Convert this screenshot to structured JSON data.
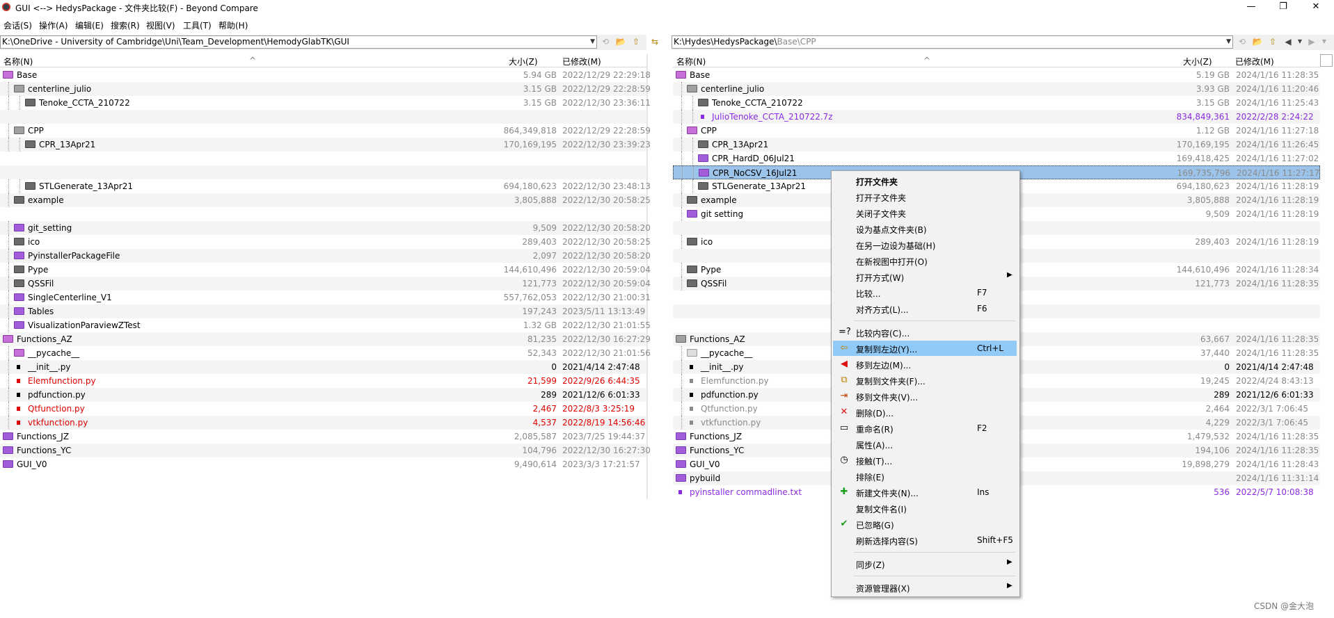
{
  "window": {
    "title": "GUI <--> HedysPackage - 文件夹比较(F) - Beyond Compare",
    "minimize": "—",
    "maximize": "❐",
    "close": "✕"
  },
  "menu": [
    "会话(S)",
    "操作(A)",
    "编辑(E)",
    "搜索(R)",
    "视图(V)",
    "工具(T)",
    "帮助(H)"
  ],
  "left_path": "K:\\OneDrive - University of Cambridge\\Uni\\Team_Development\\HemodyGlabTK\\GUI",
  "right_path_main": "K:\\Hydes\\HedysPackage\\",
  "right_path_tail": "Base\\CPP",
  "columns": {
    "name": "名称(N)",
    "size": "大小(Z)",
    "modified": "已修改(M)"
  },
  "left_rows": [
    {
      "name": "Base",
      "size": "5.94 GB",
      "date": "2022/12/29 22:29:18",
      "icon": "open",
      "indent": 0,
      "style": ""
    },
    {
      "name": "centerline_julio",
      "size": "3.15 GB",
      "date": "2022/12/29 22:28:59",
      "icon": "opengray",
      "indent": 1,
      "style": ""
    },
    {
      "name": "Tenoke_CCTA_210722",
      "size": "3.15 GB",
      "date": "2022/12/30 23:36:11",
      "icon": "gray",
      "indent": 2,
      "style": ""
    },
    {
      "name": "",
      "size": "",
      "date": "",
      "icon": "",
      "indent": 0,
      "style": ""
    },
    {
      "name": "CPP",
      "size": "864,349,818",
      "date": "2022/12/29 22:28:59",
      "icon": "opengray",
      "indent": 1,
      "style": ""
    },
    {
      "name": "CPR_13Apr21",
      "size": "170,169,195",
      "date": "2022/12/30 23:39:23",
      "icon": "gray",
      "indent": 2,
      "style": ""
    },
    {
      "name": "",
      "size": "",
      "date": "",
      "icon": "",
      "indent": 0,
      "style": ""
    },
    {
      "name": "",
      "size": "",
      "date": "",
      "icon": "",
      "indent": 0,
      "style": ""
    },
    {
      "name": "STLGenerate_13Apr21",
      "size": "694,180,623",
      "date": "2022/12/30 23:48:13",
      "icon": "gray",
      "indent": 2,
      "style": ""
    },
    {
      "name": "example",
      "size": "3,805,888",
      "date": "2022/12/30 20:58:25",
      "icon": "gray",
      "indent": 1,
      "style": ""
    },
    {
      "name": "",
      "size": "",
      "date": "",
      "icon": "",
      "indent": 0,
      "style": ""
    },
    {
      "name": "git_setting",
      "size": "9,509",
      "date": "2022/12/30 20:58:20",
      "icon": "purple",
      "indent": 1,
      "style": ""
    },
    {
      "name": "ico",
      "size": "289,403",
      "date": "2022/12/30 20:58:25",
      "icon": "gray",
      "indent": 1,
      "style": ""
    },
    {
      "name": "PyinstallerPackageFile",
      "size": "2,097",
      "date": "2022/12/30 20:58:20",
      "icon": "purple",
      "indent": 1,
      "style": ""
    },
    {
      "name": "Pype",
      "size": "144,610,496",
      "date": "2022/12/30 20:59:04",
      "icon": "gray",
      "indent": 1,
      "style": ""
    },
    {
      "name": "QSSFil",
      "size": "121,773",
      "date": "2022/12/30 20:59:04",
      "icon": "gray",
      "indent": 1,
      "style": ""
    },
    {
      "name": "SingleCenterline_V1",
      "size": "557,762,053",
      "date": "2022/12/30 21:00:31",
      "icon": "purple",
      "indent": 1,
      "style": ""
    },
    {
      "name": "Tables",
      "size": "197,243",
      "date": "2023/5/11 13:13:49",
      "icon": "purple",
      "indent": 1,
      "style": ""
    },
    {
      "name": "VisualizationParaviewZTest",
      "size": "1.32 GB",
      "date": "2022/12/30 21:01:55",
      "icon": "purple",
      "indent": 1,
      "style": ""
    },
    {
      "name": "Functions_AZ",
      "size": "81,235",
      "date": "2022/12/30 16:27:29",
      "icon": "open",
      "indent": 0,
      "style": ""
    },
    {
      "name": "__pycache__",
      "size": "52,343",
      "date": "2022/12/30 21:01:56",
      "icon": "open",
      "indent": 1,
      "style": ""
    },
    {
      "name": "__init__.py",
      "size": "0",
      "date": "2021/4/14 2:47:48",
      "icon": "file",
      "indent": 1,
      "style": "black"
    },
    {
      "name": "Elemfunction.py",
      "size": "21,599",
      "date": "2022/9/26 6:44:35",
      "icon": "filered",
      "indent": 1,
      "style": "red"
    },
    {
      "name": "pdfunction.py",
      "size": "289",
      "date": "2021/12/6 6:01:33",
      "icon": "file",
      "indent": 1,
      "style": "black"
    },
    {
      "name": "Qtfunction.py",
      "size": "2,467",
      "date": "2022/8/3 3:25:19",
      "icon": "filered",
      "indent": 1,
      "style": "red"
    },
    {
      "name": "vtkfunction.py",
      "size": "4,537",
      "date": "2022/8/19 14:56:46",
      "icon": "filered",
      "indent": 1,
      "style": "red"
    },
    {
      "name": "Functions_JZ",
      "size": "2,085,587",
      "date": "2023/7/25 19:44:37",
      "icon": "purple",
      "indent": 0,
      "style": ""
    },
    {
      "name": "Functions_YC",
      "size": "104,796",
      "date": "2022/12/30 16:27:30",
      "icon": "purple",
      "indent": 0,
      "style": ""
    },
    {
      "name": "GUI_V0",
      "size": "9,490,614",
      "date": "2023/3/3 17:21:57",
      "icon": "purple",
      "indent": 0,
      "style": ""
    }
  ],
  "right_rows": [
    {
      "name": "Base",
      "size": "5.19 GB",
      "date": "2024/1/16 11:28:35",
      "icon": "open",
      "indent": 0,
      "style": ""
    },
    {
      "name": "centerline_julio",
      "size": "3.93 GB",
      "date": "2024/1/16 11:20:46",
      "icon": "opengray",
      "indent": 1,
      "style": ""
    },
    {
      "name": "Tenoke_CCTA_210722",
      "size": "3.15 GB",
      "date": "2024/1/16 11:25:43",
      "icon": "gray",
      "indent": 2,
      "style": ""
    },
    {
      "name": "JulioTenoke_CCTA_210722.7z",
      "size": "834,849,361",
      "date": "2022/2/28 2:24:22",
      "icon": "purplefile",
      "indent": 2,
      "style": "purple"
    },
    {
      "name": "CPP",
      "size": "1.12 GB",
      "date": "2024/1/16 11:27:18",
      "icon": "open",
      "indent": 1,
      "style": ""
    },
    {
      "name": "CPR_13Apr21",
      "size": "170,169,195",
      "date": "2024/1/16 11:26:45",
      "icon": "gray",
      "indent": 2,
      "style": ""
    },
    {
      "name": "CPR_HardD_06Jul21",
      "size": "169,418,425",
      "date": "2024/1/16 11:27:02",
      "icon": "purple",
      "indent": 2,
      "style": ""
    },
    {
      "name": "CPR_NoCSV_16Jul21",
      "size": "169,735,796",
      "date": "2024/1/16 11:27:17",
      "icon": "purple",
      "indent": 2,
      "style": "sel"
    },
    {
      "name": "STLGenerate_13Apr21",
      "size": "694,180,623",
      "date": "2024/1/16 11:28:19",
      "icon": "gray",
      "indent": 2,
      "style": ""
    },
    {
      "name": "example",
      "size": "3,805,888",
      "date": "2024/1/16 11:28:19",
      "icon": "gray",
      "indent": 1,
      "style": ""
    },
    {
      "name": "git setting",
      "size": "9,509",
      "date": "2024/1/16 11:28:19",
      "icon": "purple",
      "indent": 1,
      "style": ""
    },
    {
      "name": "",
      "size": "",
      "date": "",
      "icon": "",
      "indent": 0,
      "style": ""
    },
    {
      "name": "ico",
      "size": "289,403",
      "date": "2024/1/16 11:28:19",
      "icon": "gray",
      "indent": 1,
      "style": ""
    },
    {
      "name": "",
      "size": "",
      "date": "",
      "icon": "",
      "indent": 0,
      "style": ""
    },
    {
      "name": "Pype",
      "size": "144,610,496",
      "date": "2024/1/16 11:28:34",
      "icon": "gray",
      "indent": 1,
      "style": ""
    },
    {
      "name": "QSSFil",
      "size": "121,773",
      "date": "2024/1/16 11:28:35",
      "icon": "gray",
      "indent": 1,
      "style": ""
    },
    {
      "name": "",
      "size": "",
      "date": "",
      "icon": "",
      "indent": 0,
      "style": ""
    },
    {
      "name": "",
      "size": "",
      "date": "",
      "icon": "",
      "indent": 0,
      "style": ""
    },
    {
      "name": "",
      "size": "",
      "date": "",
      "icon": "",
      "indent": 0,
      "style": ""
    },
    {
      "name": "Functions_AZ",
      "size": "63,667",
      "date": "2024/1/16 11:28:35",
      "icon": "opengray",
      "indent": 0,
      "style": ""
    },
    {
      "name": "__pycache__",
      "size": "37,440",
      "date": "2024/1/16 11:28:35",
      "icon": "light",
      "indent": 1,
      "style": ""
    },
    {
      "name": "__init__.py",
      "size": "0",
      "date": "2021/4/14 2:47:48",
      "icon": "file",
      "indent": 1,
      "style": "black"
    },
    {
      "name": "Elemfunction.py",
      "size": "19,245",
      "date": "2022/4/24 8:43:13",
      "icon": "filegray",
      "indent": 1,
      "style": "gray"
    },
    {
      "name": "pdfunction.py",
      "size": "289",
      "date": "2021/12/6 6:01:33",
      "icon": "file",
      "indent": 1,
      "style": "black"
    },
    {
      "name": "Qtfunction.py",
      "size": "2,464",
      "date": "2022/3/1 7:06:45",
      "icon": "filegray",
      "indent": 1,
      "style": "gray"
    },
    {
      "name": "vtkfunction.py",
      "size": "4,229",
      "date": "2022/3/1 7:06:45",
      "icon": "filegray",
      "indent": 1,
      "style": "gray"
    },
    {
      "name": "Functions_JZ",
      "size": "1,479,532",
      "date": "2024/1/16 11:28:35",
      "icon": "purple",
      "indent": 0,
      "style": ""
    },
    {
      "name": "Functions_YC",
      "size": "194,106",
      "date": "2024/1/16 11:28:35",
      "icon": "purple",
      "indent": 0,
      "style": ""
    },
    {
      "name": "GUI_V0",
      "size": "19,898,279",
      "date": "2024/1/16 11:28:43",
      "icon": "purple",
      "indent": 0,
      "style": ""
    },
    {
      "name": "pybuild",
      "size": "",
      "date": "2024/1/16 11:31:14",
      "icon": "purple",
      "indent": 0,
      "style": ""
    },
    {
      "name": "pyinstaller commadline.txt",
      "size": "536",
      "date": "2022/5/7 10:08:38",
      "icon": "purplefile",
      "indent": 0,
      "style": "purple"
    }
  ],
  "context_menu": [
    {
      "label": "打开文件夹",
      "shortcut": "",
      "bold": true,
      "icon": "",
      "icon_name": ""
    },
    {
      "label": "打开子文件夹",
      "shortcut": "",
      "icon": "",
      "icon_name": ""
    },
    {
      "label": "关闭子文件夹",
      "shortcut": "",
      "icon": "",
      "icon_name": ""
    },
    {
      "label": "设为基点文件夹(B)",
      "shortcut": "",
      "icon": "",
      "icon_name": ""
    },
    {
      "label": "在另一边设为基础(H)",
      "shortcut": "",
      "icon": "",
      "icon_name": ""
    },
    {
      "label": "在新视图中打开(O)",
      "shortcut": "",
      "icon": "",
      "icon_name": ""
    },
    {
      "label": "打开方式(W)",
      "shortcut": "",
      "submenu": true,
      "icon": "",
      "icon_name": ""
    },
    {
      "label": "比较...",
      "shortcut": "F7",
      "icon": "",
      "icon_name": ""
    },
    {
      "label": "对齐方式(L)...",
      "shortcut": "F6",
      "icon": "",
      "icon_name": ""
    },
    {
      "sep": true
    },
    {
      "label": "比较内容(C)...",
      "shortcut": "",
      "icon": "=?",
      "icon_name": "compare-contents-icon"
    },
    {
      "label": "复制到左边(Y)...",
      "shortcut": "Ctrl+L",
      "highlight": true,
      "icon": "⇦",
      "icon_name": "copy-left-icon"
    },
    {
      "label": "移到左边(M)...",
      "shortcut": "",
      "icon": "◀",
      "icon_name": "move-left-icon"
    },
    {
      "label": "复制到文件夹(F)...",
      "shortcut": "",
      "icon": "⧉",
      "icon_name": "copy-to-folder-icon"
    },
    {
      "label": "移到文件夹(V)...",
      "shortcut": "",
      "icon": "⇥",
      "icon_name": "move-to-folder-icon"
    },
    {
      "label": "删除(D)...",
      "shortcut": "",
      "icon": "✕",
      "icon_name": "delete-icon"
    },
    {
      "label": "重命名(R)",
      "shortcut": "F2",
      "icon": "▭",
      "icon_name": "rename-icon"
    },
    {
      "label": "属性(A)...",
      "shortcut": "",
      "icon": "",
      "icon_name": ""
    },
    {
      "label": "接触(T)...",
      "shortcut": "",
      "icon": "◷",
      "icon_name": "touch-icon"
    },
    {
      "label": "排除(E)",
      "shortcut": "",
      "icon": "",
      "icon_name": ""
    },
    {
      "label": "新建文件夹(N)...",
      "shortcut": "Ins",
      "icon": "✚",
      "icon_name": "new-folder-icon"
    },
    {
      "label": "复制文件名(I)",
      "shortcut": "",
      "icon": "",
      "icon_name": ""
    },
    {
      "label": "已忽略(G)",
      "shortcut": "",
      "icon": "✔",
      "icon_name": "checkmark-icon"
    },
    {
      "label": "刷新选择内容(S)",
      "shortcut": "Shift+F5",
      "icon": "",
      "icon_name": ""
    },
    {
      "sep": true
    },
    {
      "label": "同步(Z)",
      "shortcut": "",
      "submenu": true,
      "icon": "",
      "icon_name": ""
    },
    {
      "sep": true
    },
    {
      "label": "资源管理器(X)",
      "shortcut": "",
      "submenu": true,
      "icon": "",
      "icon_name": ""
    }
  ],
  "watermark": "CSDN @金大泡"
}
